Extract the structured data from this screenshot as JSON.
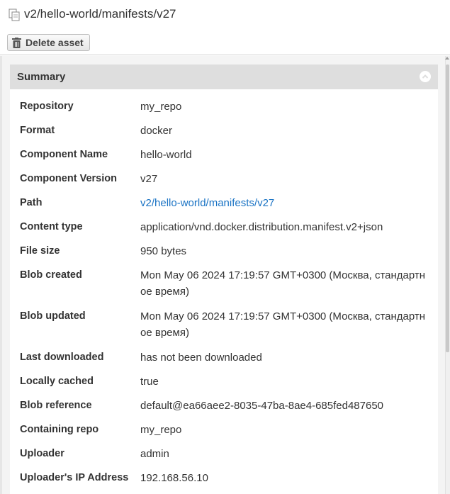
{
  "window": {
    "title": "v2/hello-world/manifests/v27",
    "icon": "copy-documents-icon"
  },
  "toolbar": {
    "delete_label": "Delete asset",
    "delete_icon": "trash-icon"
  },
  "summary": {
    "title": "Summary",
    "collapse_icon": "chevron-up-icon",
    "rows": [
      {
        "label": "Repository",
        "value": "my_repo"
      },
      {
        "label": "Format",
        "value": "docker"
      },
      {
        "label": "Component Name",
        "value": "hello-world"
      },
      {
        "label": "Component Version",
        "value": "v27"
      },
      {
        "label": "Path",
        "value": "v2/hello-world/manifests/v27"
      },
      {
        "label": "Content type",
        "value": "application/vnd.docker.distribution.manifest.v2+json"
      },
      {
        "label": "File size",
        "value": "950 bytes"
      },
      {
        "label": "Blob created",
        "value": "Mon May 06 2024 17:19:57 GMT+0300 (Москва, стандартное время)"
      },
      {
        "label": "Blob updated",
        "value": "Mon May 06 2024 17:19:57 GMT+0300 (Москва, стандартное время)"
      },
      {
        "label": "Last downloaded",
        "value": "has not been downloaded"
      },
      {
        "label": "Locally cached",
        "value": "true"
      },
      {
        "label": "Blob reference",
        "value": "default@ea66aee2-8035-47ba-8ae4-685fed487650"
      },
      {
        "label": "Containing repo",
        "value": "my_repo"
      },
      {
        "label": "Uploader",
        "value": "admin"
      },
      {
        "label": "Uploader's IP Address",
        "value": "192.168.56.10"
      }
    ]
  },
  "colors": {
    "link": "#1a73c4",
    "header_bg": "#dedede",
    "content_bg": "#f4f4f4"
  }
}
